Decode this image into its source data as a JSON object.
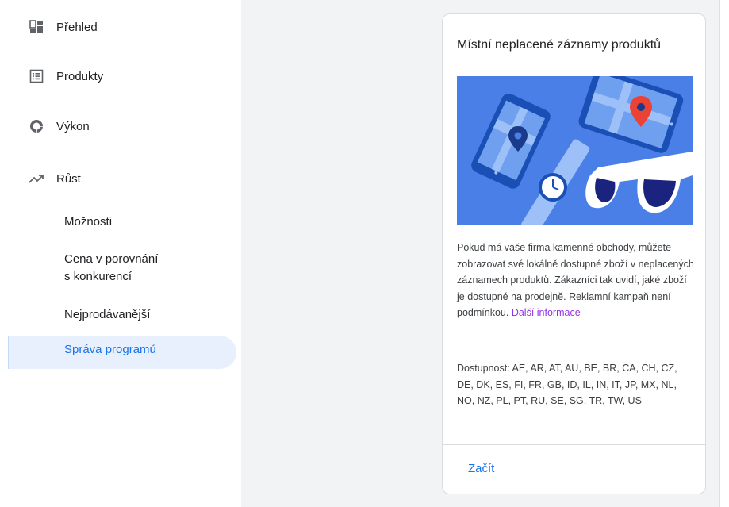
{
  "sidebar": {
    "items": [
      {
        "icon": "dashboard-icon",
        "label": "Přehled"
      },
      {
        "icon": "list-icon",
        "label": "Produkty"
      },
      {
        "icon": "donut-chart-icon",
        "label": "Výkon"
      },
      {
        "icon": "trending-up-icon",
        "label": "Růst"
      }
    ],
    "sub_items": [
      {
        "label": "Možnosti"
      },
      {
        "label": "Cena v porovnání\ns konkurencí"
      },
      {
        "label": "Nejprodávanější"
      },
      {
        "label": "Správa programů",
        "active": true
      }
    ]
  },
  "card": {
    "title": "Místní neplacené záznamy produktů",
    "illustration": "maps-phones-watch-sunglasses-illustration",
    "description": "Pokud má vaše firma kamenné obchody, můžete zobrazovat své lokálně dostupné zboží v neplacených záznamech produktů. Zákazníci tak uvidí, jaké zboží je dostupné na prodejně. Reklamní kampaň není podmínkou.",
    "learn_more": "Další informace",
    "availability": "Dostupnost: AE, AR, AT, AU, BE, BR, CA, CH, CZ, DE, DK, ES, FI, FR, GB, ID, IL, IN, IT, JP, MX, NL, NO, NZ, PL, PT, RU, SE, SG, TR, TW, US",
    "action": "Začít"
  },
  "colors": {
    "accent": "#1a73e8",
    "active_bg": "#e8f0fe",
    "link_visited": "#9334e6",
    "illustration_bg": "#4a7fe8",
    "pin_red": "#ea4335"
  }
}
